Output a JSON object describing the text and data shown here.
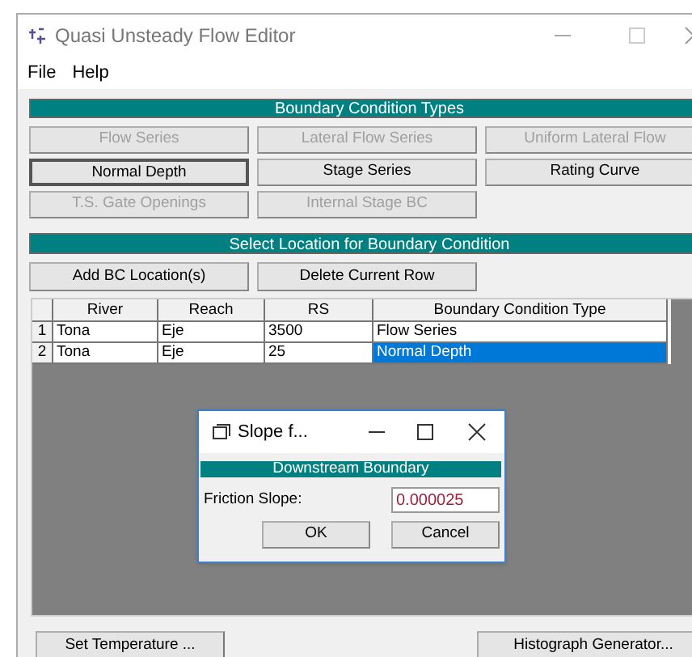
{
  "window": {
    "title": "Quasi Unsteady Flow Editor"
  },
  "menu": [
    "File",
    "Help"
  ],
  "boundary_condition_types": {
    "title": "Boundary Condition Types",
    "buttons": [
      {
        "label": "Flow Series",
        "disabled": true,
        "selected": false
      },
      {
        "label": "Lateral Flow Series",
        "disabled": true,
        "selected": false
      },
      {
        "label": "Uniform Lateral Flow",
        "disabled": true,
        "selected": false
      },
      {
        "label": "Normal Depth",
        "disabled": false,
        "selected": true
      },
      {
        "label": "Stage Series",
        "disabled": false,
        "selected": false
      },
      {
        "label": "Rating Curve",
        "disabled": false,
        "selected": false
      },
      {
        "label": "T.S. Gate Openings",
        "disabled": true,
        "selected": false
      },
      {
        "label": "Internal Stage BC",
        "disabled": true,
        "selected": false
      }
    ]
  },
  "location": {
    "title": "Select Location for Boundary Condition",
    "buttons": [
      "Add BC Location(s)",
      "Delete Current Row"
    ]
  },
  "table": {
    "columns": [
      "River",
      "Reach",
      "RS",
      "Boundary Condition Type"
    ],
    "rows": [
      {
        "number": "1",
        "cells": [
          "Tona",
          "Eje",
          "3500",
          "Flow Series"
        ],
        "selected": false
      },
      {
        "number": "2",
        "cells": [
          "Tona",
          "Eje",
          "25",
          "Normal Depth"
        ],
        "selected": true
      }
    ]
  },
  "dialog": {
    "title": "Slope f...",
    "header": "Downstream Boundary",
    "label": "Friction Slope:",
    "value": "0.000025",
    "buttons": [
      "OK",
      "Cancel"
    ]
  },
  "bottom_buttons": [
    "Set Temperature ...",
    "Histograph Generator..."
  ]
}
